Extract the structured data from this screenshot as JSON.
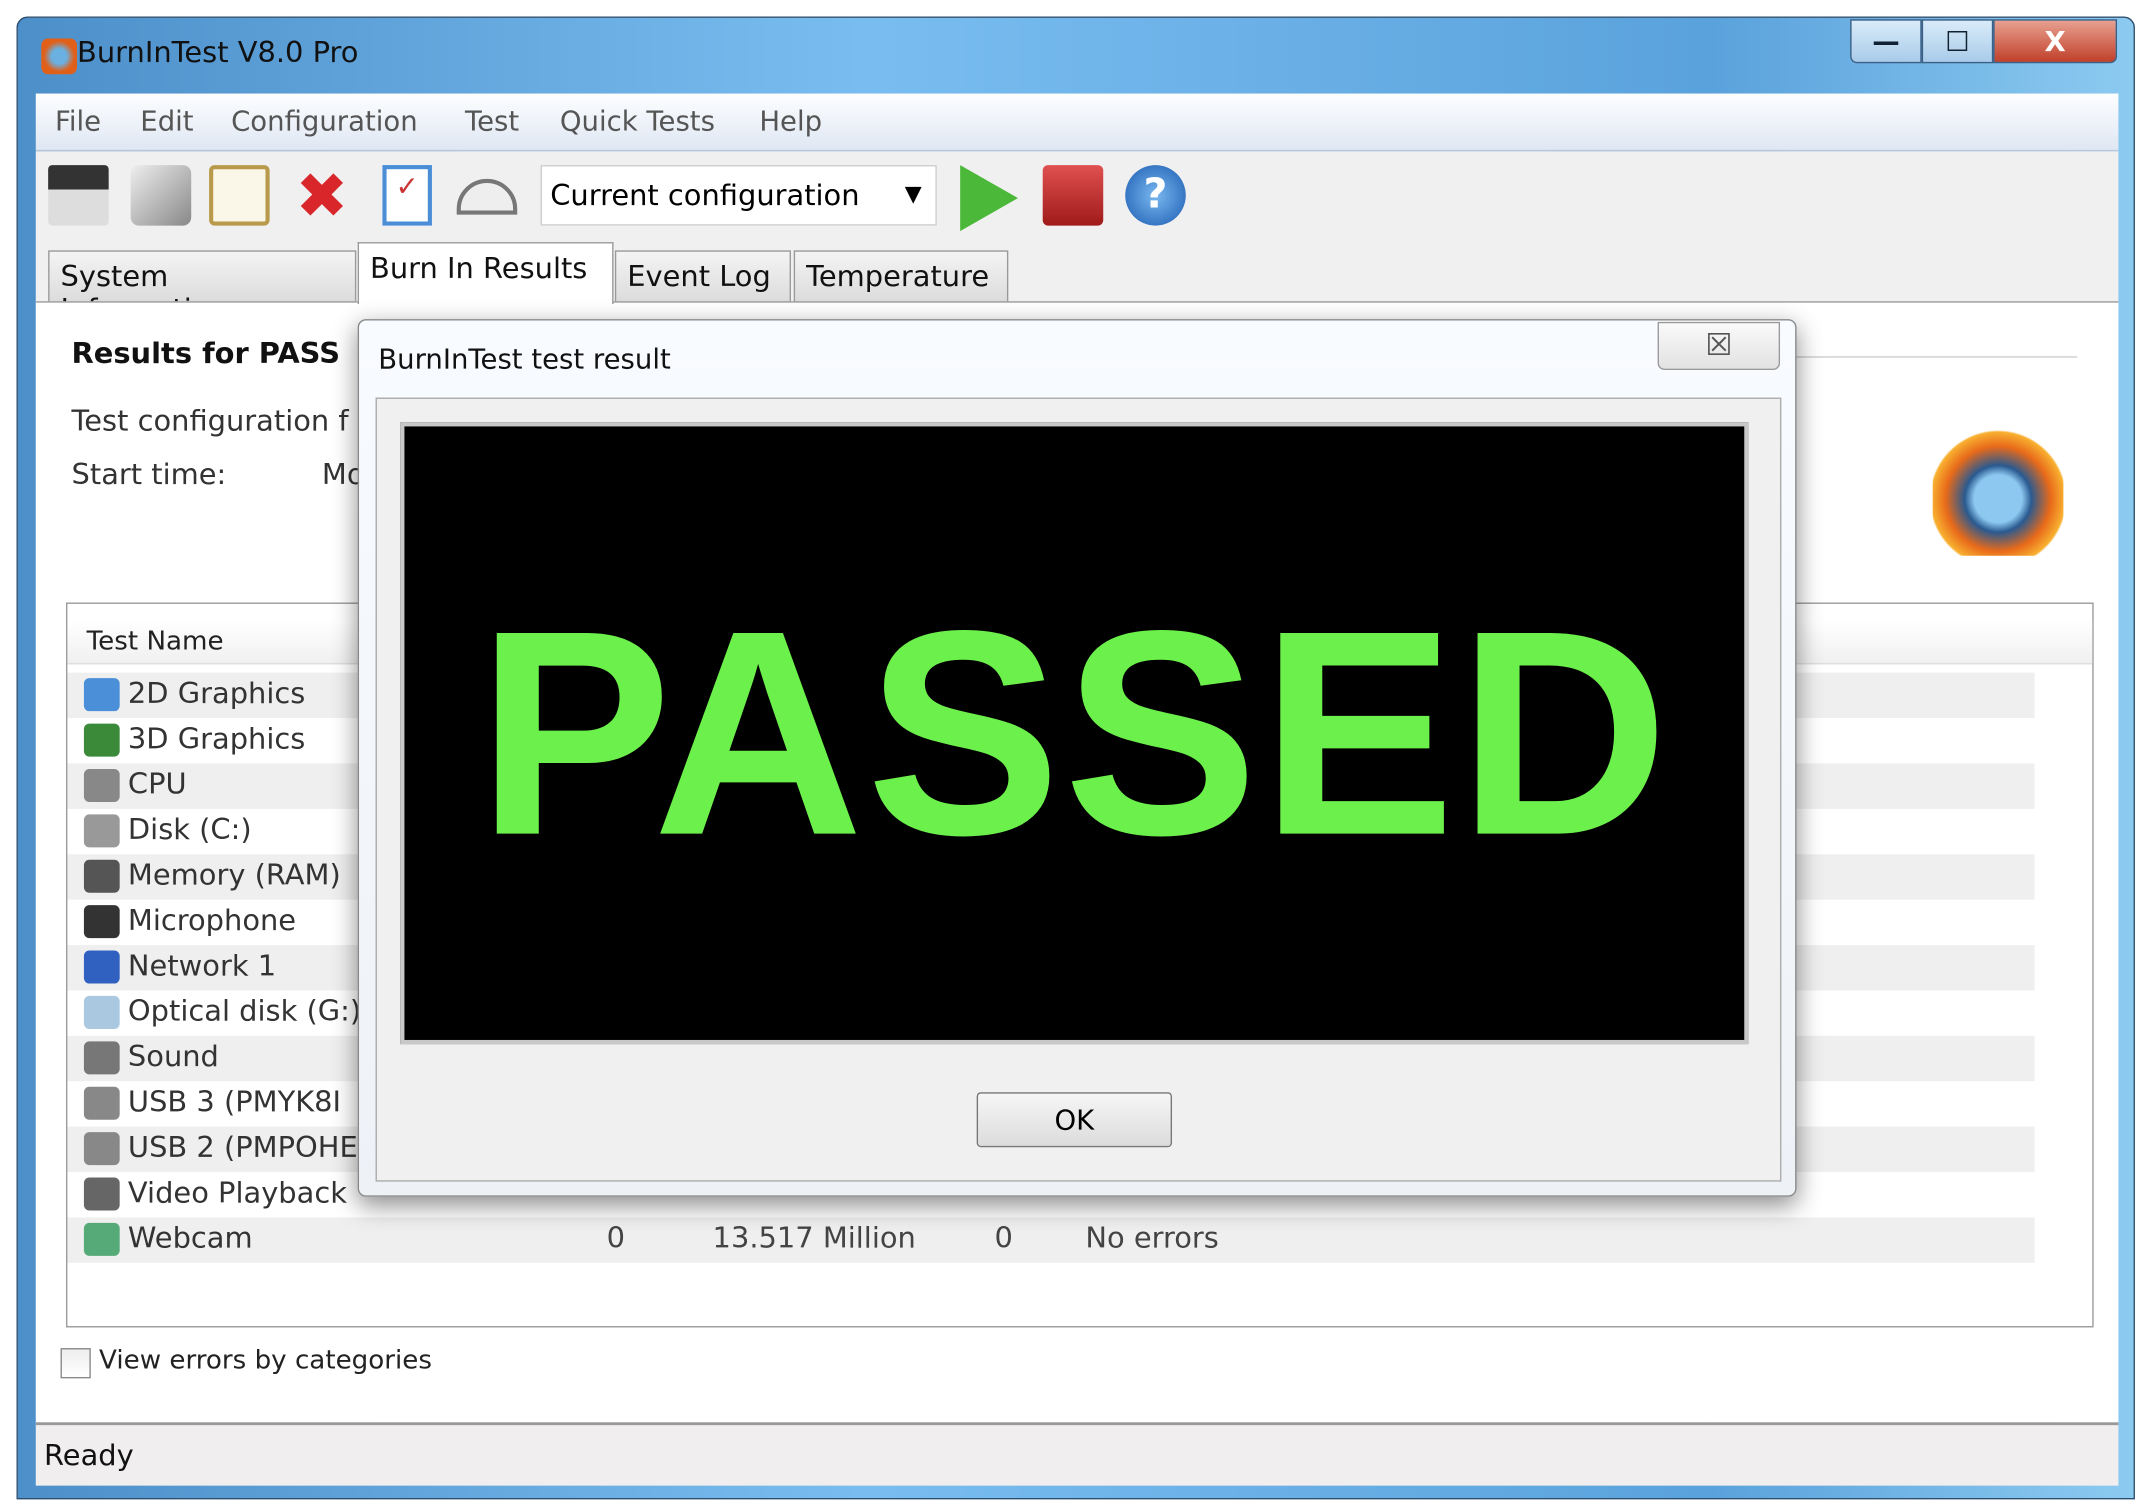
{
  "window": {
    "title": "BurnInTest V8.0 Pro",
    "min": "—",
    "max": "☐",
    "close": "X"
  },
  "menu": [
    "File",
    "Edit",
    "Configuration",
    "Test",
    "Quick Tests",
    "Help"
  ],
  "toolbar": {
    "config_select": "Current configuration",
    "icons": [
      "save-report-icon",
      "printer-icon",
      "clipboard-icon",
      "clear-icon",
      "test-selection-icon",
      "test-duration-icon",
      "start-icon",
      "stop-icon",
      "help-icon"
    ]
  },
  "tabs": [
    "System Information",
    "Burn In Results",
    "Event Log",
    "Temperature"
  ],
  "results": {
    "heading": "Results for PASS",
    "config_label": "Test configuration f",
    "start_label": "Start time:",
    "start_value": "Mo"
  },
  "table": {
    "header": "Test Name",
    "rows": [
      {
        "name": "2D Graphics",
        "color": "#4a8fd8"
      },
      {
        "name": "3D Graphics",
        "color": "#3a8a3a"
      },
      {
        "name": "CPU",
        "color": "#888"
      },
      {
        "name": "Disk (C:)",
        "color": "#999"
      },
      {
        "name": "Memory (RAM)",
        "color": "#555"
      },
      {
        "name": "Microphone",
        "color": "#333"
      },
      {
        "name": "Network 1",
        "color": "#3060c0"
      },
      {
        "name": "Optical disk (G:)",
        "color": "#aac8e0"
      },
      {
        "name": "Sound",
        "color": "#777"
      },
      {
        "name": "USB 3 (PMYK8I",
        "color": "#888"
      },
      {
        "name": "USB 2 (PMPOHE",
        "color": "#888"
      },
      {
        "name": "Video Playback",
        "color": "#666"
      },
      {
        "name": "Webcam",
        "color": "#5a7"
      }
    ],
    "webcam_values": [
      "0",
      "13.517 Million",
      "0",
      "No errors"
    ]
  },
  "checkbox": {
    "label": "View errors by categories",
    "checked": false
  },
  "status": "Ready",
  "dialog": {
    "title": "BurnInTest test result",
    "result": "PASSED",
    "ok": "OK",
    "close": "☒",
    "result_color": "#6cf04b"
  }
}
